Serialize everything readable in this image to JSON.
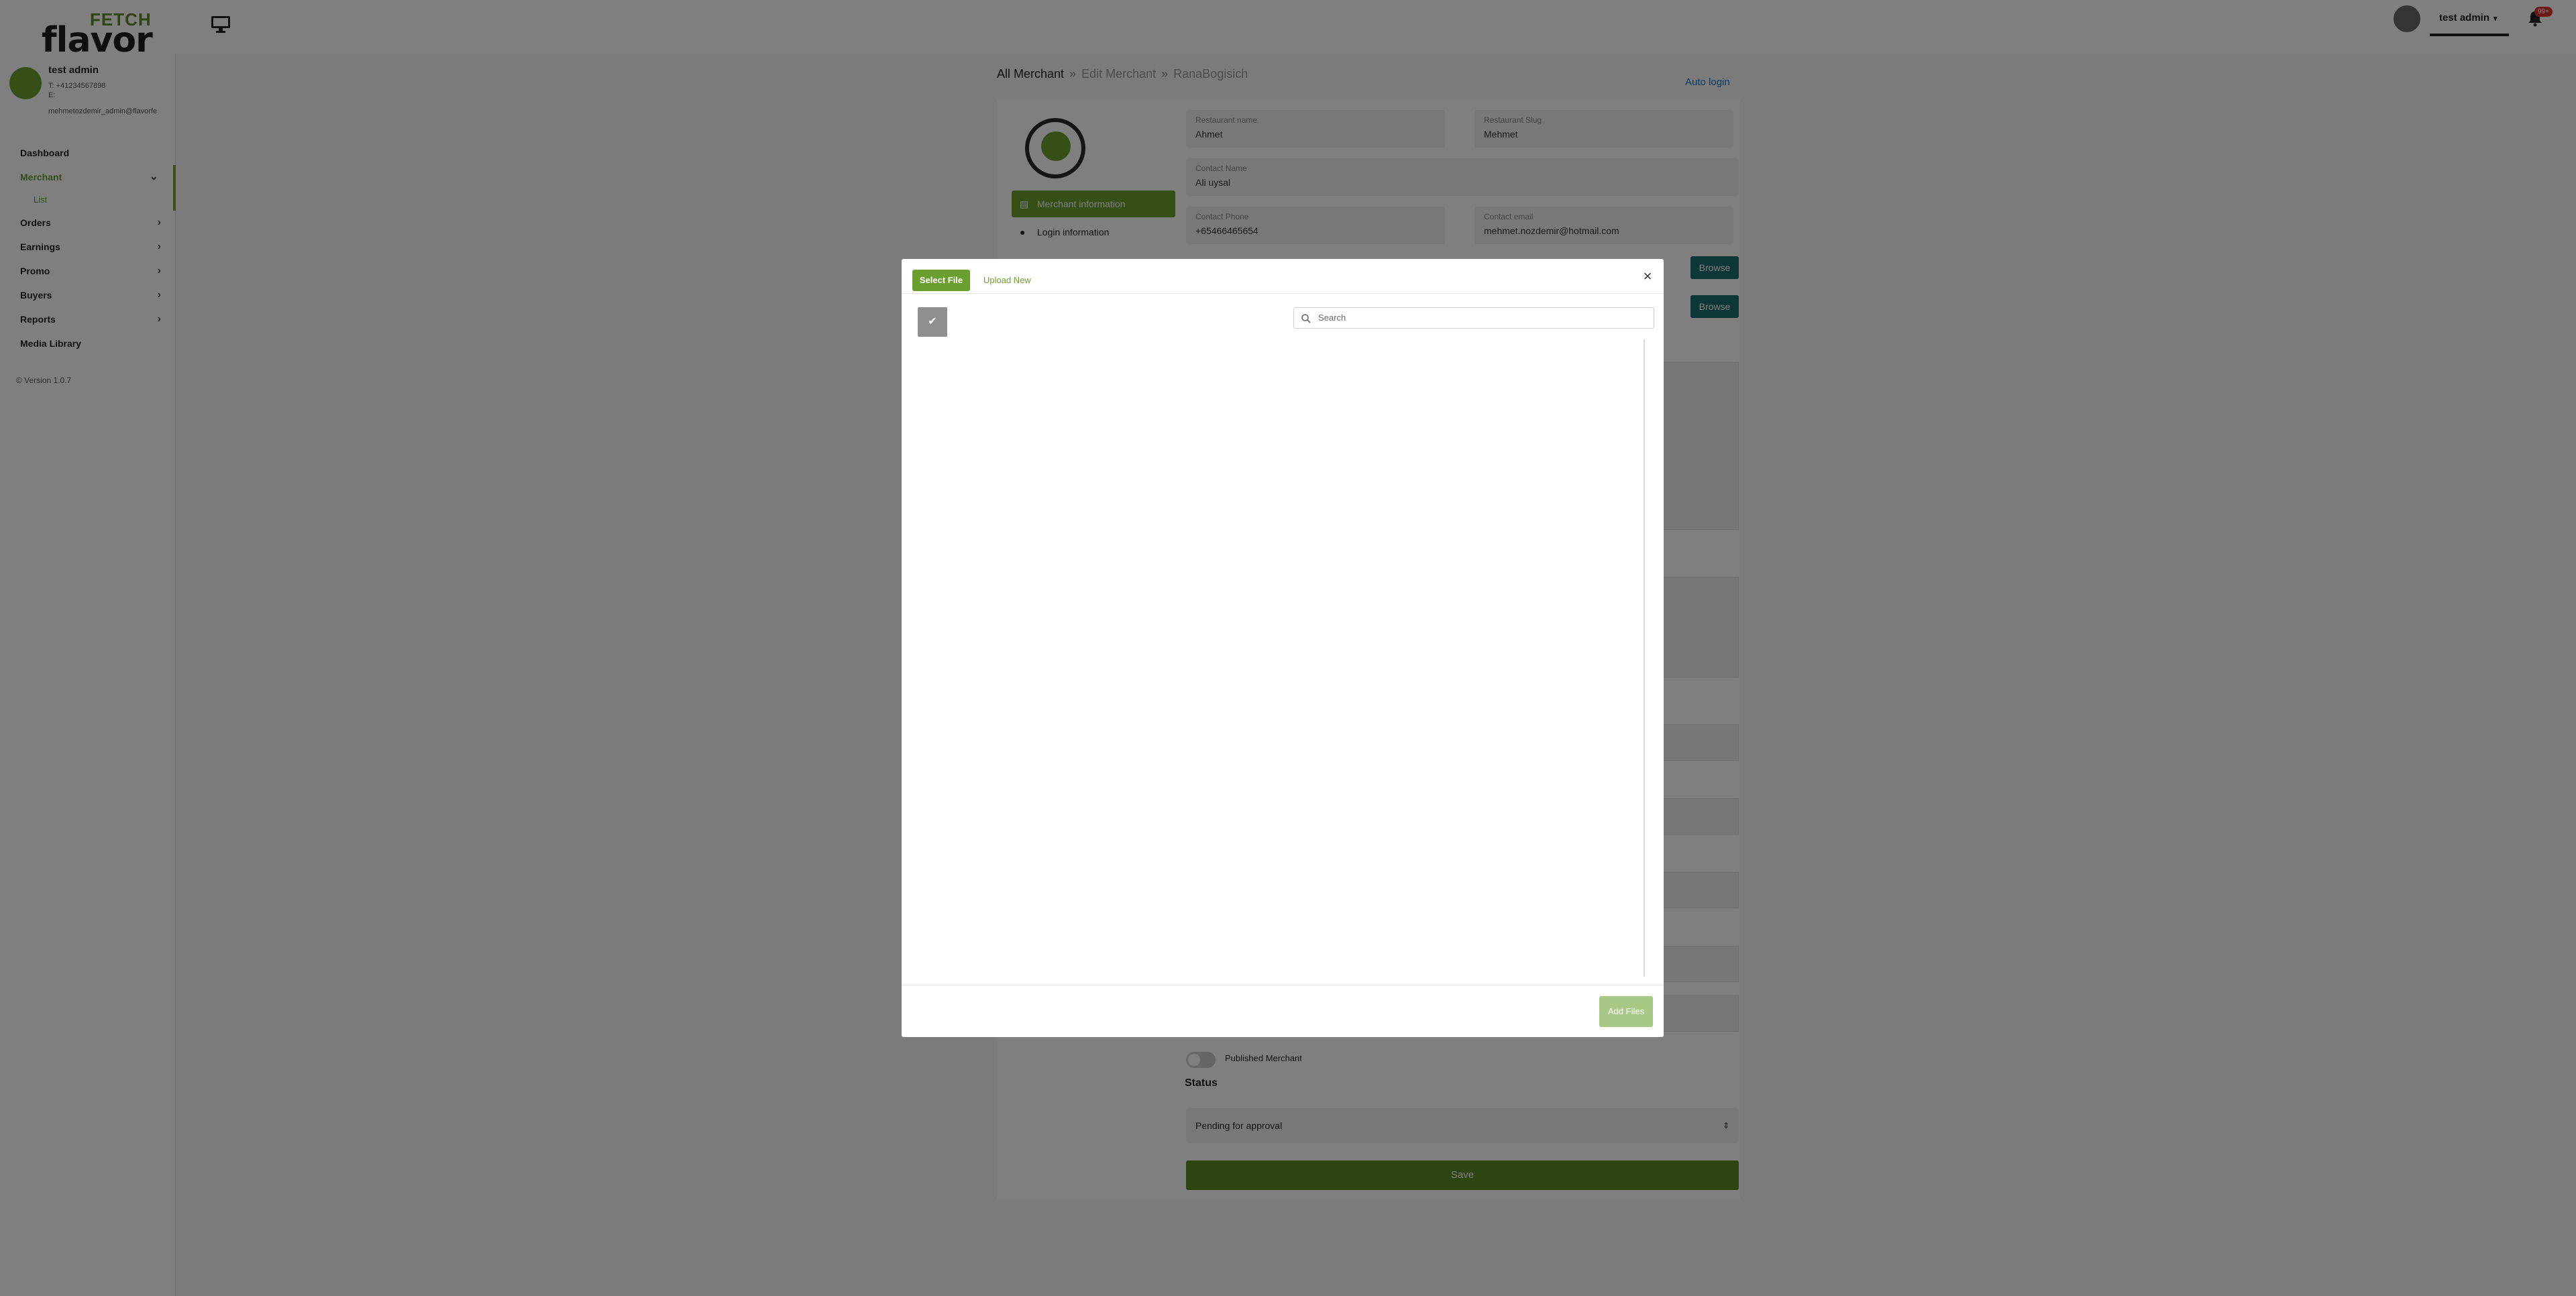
{
  "brand": {
    "logo_top": "FETCH",
    "logo_bottom": "flavor"
  },
  "topbar": {
    "user_menu_label": "test admin",
    "notification_count": "99+"
  },
  "profile": {
    "name": "test admin",
    "phone": "T: +41234567898",
    "line2": "E:",
    "email": "mehmetozdemir_admin@flavorfe"
  },
  "nav": {
    "dashboard": "Dashboard",
    "merchant": "Merchant",
    "merchant_list": "List",
    "orders": "Orders",
    "earnings": "Earnings",
    "promo": "Promo",
    "buyers": "Buyers",
    "reports": "Reports",
    "media_library": "Media Library"
  },
  "version": "© Version 1.0.7",
  "breadcrumb": {
    "root": "All Merchant",
    "mid": "Edit Merchant",
    "leaf": "RanaBogisich"
  },
  "auto_login": "Auto login",
  "merchant_tabs": {
    "info": "Merchant information",
    "login": "Login information"
  },
  "form": {
    "restaurant_name": {
      "label": "Restaurant name",
      "value": "Ahmet"
    },
    "restaurant_slug": {
      "label": "Restaurant Slug",
      "value": "Mehmet"
    },
    "contact_name": {
      "label": "Contact Name",
      "value": "Ali uysal"
    },
    "contact_phone": {
      "label": "Contact Phone",
      "value": "+65466465654"
    },
    "contact_email": {
      "label": "Contact email",
      "value": "mehmet.nozdemir@hotmail.com"
    },
    "browse_label": "Browse",
    "published_label": "Published Merchant",
    "status_label": "Status",
    "status_value": "Pending for approval",
    "save_label": "Save"
  },
  "modal": {
    "tab_select": "Select File",
    "tab_upload": "Upload New",
    "search_placeholder": "Search",
    "add_files": "Add Files"
  },
  "colors": {
    "accent": "#6a9e2e",
    "browse": "#1a6e6e",
    "save": "#5c8a24"
  }
}
